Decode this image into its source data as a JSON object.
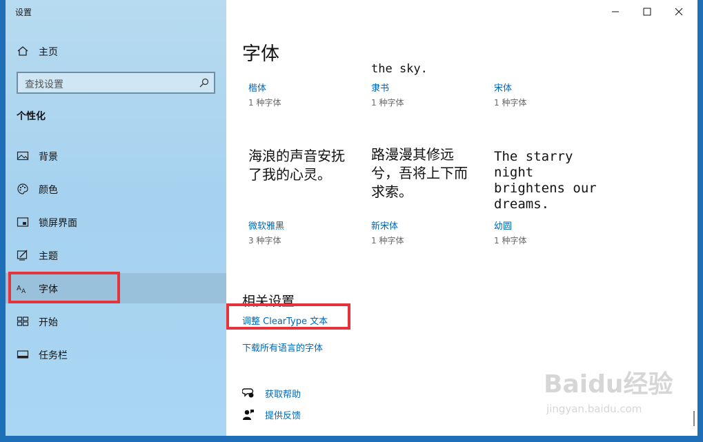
{
  "window": {
    "title": "设置"
  },
  "sidebar": {
    "home_label": "主页",
    "search_placeholder": "查找设置",
    "section_title": "个性化",
    "items": [
      {
        "label": "背景",
        "icon": "image-icon"
      },
      {
        "label": "颜色",
        "icon": "palette-icon"
      },
      {
        "label": "锁屏界面",
        "icon": "lock-screen-icon"
      },
      {
        "label": "主题",
        "icon": "theme-icon"
      },
      {
        "label": "字体",
        "icon": "font-icon",
        "selected": true
      },
      {
        "label": "开始",
        "icon": "start-icon"
      },
      {
        "label": "任务栏",
        "icon": "taskbar-icon"
      }
    ]
  },
  "main": {
    "title": "字体",
    "partial_sample": "the sky.",
    "fonts_row1": [
      {
        "name": "楷体",
        "count": "1 种字体"
      },
      {
        "name": "隶书",
        "count": "1 种字体"
      },
      {
        "name": "宋体",
        "count": "1 种字体"
      }
    ],
    "fonts_row2": [
      {
        "sample": "海浪的声音安抚\n了我的心灵。",
        "name": "微软雅黑",
        "count": "3 种字体"
      },
      {
        "sample": "路漫漫其修远\n兮，吾将上下而\n求索。",
        "name": "新宋体",
        "count": "1 种字体"
      },
      {
        "sample": "The starry\nnight\nbrightens our\ndreams.",
        "name": "幼圆",
        "count": "1 种字体"
      }
    ],
    "related_title": "相关设置",
    "links": {
      "cleartype": "调整 ClearType 文本",
      "download": "下载所有语言的字体"
    },
    "help": {
      "get_help": "获取帮助",
      "feedback": "提供反馈"
    }
  },
  "watermark": {
    "brand": "Baidu经验",
    "url": "jingyan.baidu.com"
  },
  "colors": {
    "accent": "#0067b8",
    "highlight": "#e5333c",
    "desktop": "#1e6fb8"
  }
}
